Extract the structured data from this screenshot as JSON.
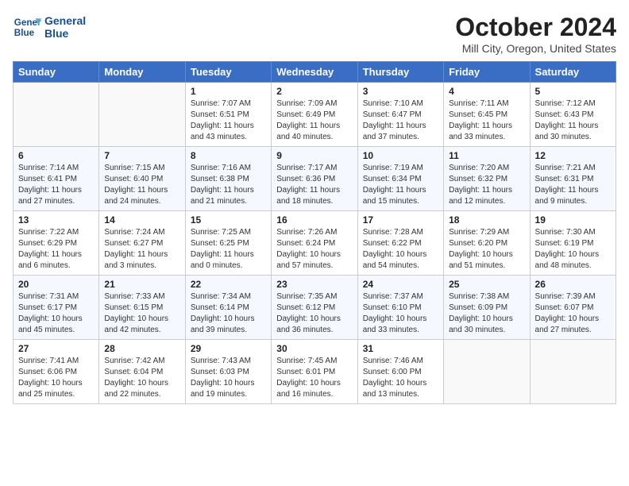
{
  "logo": {
    "line1": "General",
    "line2": "Blue"
  },
  "title": "October 2024",
  "location": "Mill City, Oregon, United States",
  "days": [
    "Sunday",
    "Monday",
    "Tuesday",
    "Wednesday",
    "Thursday",
    "Friday",
    "Saturday"
  ],
  "weeks": [
    [
      {
        "num": "",
        "info": ""
      },
      {
        "num": "",
        "info": ""
      },
      {
        "num": "1",
        "info": "Sunrise: 7:07 AM\nSunset: 6:51 PM\nDaylight: 11 hours and 43 minutes."
      },
      {
        "num": "2",
        "info": "Sunrise: 7:09 AM\nSunset: 6:49 PM\nDaylight: 11 hours and 40 minutes."
      },
      {
        "num": "3",
        "info": "Sunrise: 7:10 AM\nSunset: 6:47 PM\nDaylight: 11 hours and 37 minutes."
      },
      {
        "num": "4",
        "info": "Sunrise: 7:11 AM\nSunset: 6:45 PM\nDaylight: 11 hours and 33 minutes."
      },
      {
        "num": "5",
        "info": "Sunrise: 7:12 AM\nSunset: 6:43 PM\nDaylight: 11 hours and 30 minutes."
      }
    ],
    [
      {
        "num": "6",
        "info": "Sunrise: 7:14 AM\nSunset: 6:41 PM\nDaylight: 11 hours and 27 minutes."
      },
      {
        "num": "7",
        "info": "Sunrise: 7:15 AM\nSunset: 6:40 PM\nDaylight: 11 hours and 24 minutes."
      },
      {
        "num": "8",
        "info": "Sunrise: 7:16 AM\nSunset: 6:38 PM\nDaylight: 11 hours and 21 minutes."
      },
      {
        "num": "9",
        "info": "Sunrise: 7:17 AM\nSunset: 6:36 PM\nDaylight: 11 hours and 18 minutes."
      },
      {
        "num": "10",
        "info": "Sunrise: 7:19 AM\nSunset: 6:34 PM\nDaylight: 11 hours and 15 minutes."
      },
      {
        "num": "11",
        "info": "Sunrise: 7:20 AM\nSunset: 6:32 PM\nDaylight: 11 hours and 12 minutes."
      },
      {
        "num": "12",
        "info": "Sunrise: 7:21 AM\nSunset: 6:31 PM\nDaylight: 11 hours and 9 minutes."
      }
    ],
    [
      {
        "num": "13",
        "info": "Sunrise: 7:22 AM\nSunset: 6:29 PM\nDaylight: 11 hours and 6 minutes."
      },
      {
        "num": "14",
        "info": "Sunrise: 7:24 AM\nSunset: 6:27 PM\nDaylight: 11 hours and 3 minutes."
      },
      {
        "num": "15",
        "info": "Sunrise: 7:25 AM\nSunset: 6:25 PM\nDaylight: 11 hours and 0 minutes."
      },
      {
        "num": "16",
        "info": "Sunrise: 7:26 AM\nSunset: 6:24 PM\nDaylight: 10 hours and 57 minutes."
      },
      {
        "num": "17",
        "info": "Sunrise: 7:28 AM\nSunset: 6:22 PM\nDaylight: 10 hours and 54 minutes."
      },
      {
        "num": "18",
        "info": "Sunrise: 7:29 AM\nSunset: 6:20 PM\nDaylight: 10 hours and 51 minutes."
      },
      {
        "num": "19",
        "info": "Sunrise: 7:30 AM\nSunset: 6:19 PM\nDaylight: 10 hours and 48 minutes."
      }
    ],
    [
      {
        "num": "20",
        "info": "Sunrise: 7:31 AM\nSunset: 6:17 PM\nDaylight: 10 hours and 45 minutes."
      },
      {
        "num": "21",
        "info": "Sunrise: 7:33 AM\nSunset: 6:15 PM\nDaylight: 10 hours and 42 minutes."
      },
      {
        "num": "22",
        "info": "Sunrise: 7:34 AM\nSunset: 6:14 PM\nDaylight: 10 hours and 39 minutes."
      },
      {
        "num": "23",
        "info": "Sunrise: 7:35 AM\nSunset: 6:12 PM\nDaylight: 10 hours and 36 minutes."
      },
      {
        "num": "24",
        "info": "Sunrise: 7:37 AM\nSunset: 6:10 PM\nDaylight: 10 hours and 33 minutes."
      },
      {
        "num": "25",
        "info": "Sunrise: 7:38 AM\nSunset: 6:09 PM\nDaylight: 10 hours and 30 minutes."
      },
      {
        "num": "26",
        "info": "Sunrise: 7:39 AM\nSunset: 6:07 PM\nDaylight: 10 hours and 27 minutes."
      }
    ],
    [
      {
        "num": "27",
        "info": "Sunrise: 7:41 AM\nSunset: 6:06 PM\nDaylight: 10 hours and 25 minutes."
      },
      {
        "num": "28",
        "info": "Sunrise: 7:42 AM\nSunset: 6:04 PM\nDaylight: 10 hours and 22 minutes."
      },
      {
        "num": "29",
        "info": "Sunrise: 7:43 AM\nSunset: 6:03 PM\nDaylight: 10 hours and 19 minutes."
      },
      {
        "num": "30",
        "info": "Sunrise: 7:45 AM\nSunset: 6:01 PM\nDaylight: 10 hours and 16 minutes."
      },
      {
        "num": "31",
        "info": "Sunrise: 7:46 AM\nSunset: 6:00 PM\nDaylight: 10 hours and 13 minutes."
      },
      {
        "num": "",
        "info": ""
      },
      {
        "num": "",
        "info": ""
      }
    ]
  ]
}
